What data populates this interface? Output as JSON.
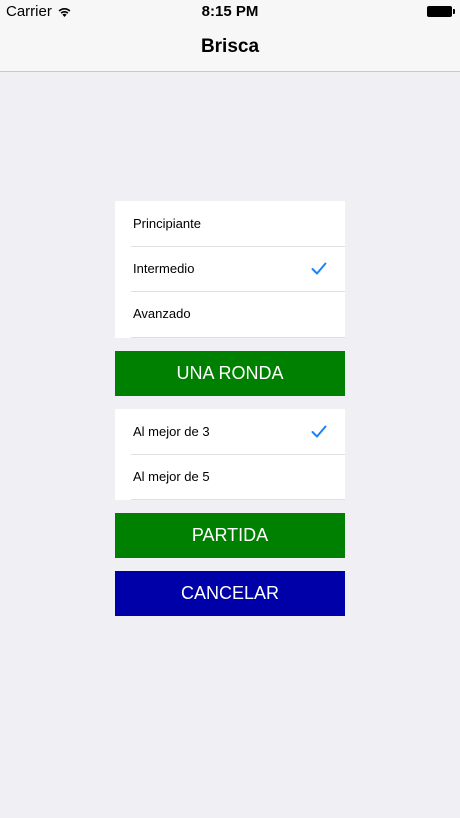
{
  "status_bar": {
    "carrier": "Carrier",
    "time": "8:15 PM",
    "wifi_icon": "wifi-icon",
    "battery_icon": "battery-icon"
  },
  "nav": {
    "title": "Brisca"
  },
  "difficulty": {
    "items": [
      {
        "label": "Principiante",
        "selected": false
      },
      {
        "label": "Intermedio",
        "selected": true
      },
      {
        "label": "Avanzado",
        "selected": false
      }
    ]
  },
  "round_button": {
    "label": "UNA RONDA",
    "color": "#008000"
  },
  "match_length": {
    "items": [
      {
        "label": "Al mejor de 3",
        "selected": true
      },
      {
        "label": "Al mejor de 5",
        "selected": false
      }
    ]
  },
  "match_button": {
    "label": "PARTIDA",
    "color": "#008000"
  },
  "cancel_button": {
    "label": "CANCELAR",
    "color": "#0000a8"
  },
  "colors": {
    "background": "#efeff4",
    "checkmark": "#1a82fb"
  }
}
